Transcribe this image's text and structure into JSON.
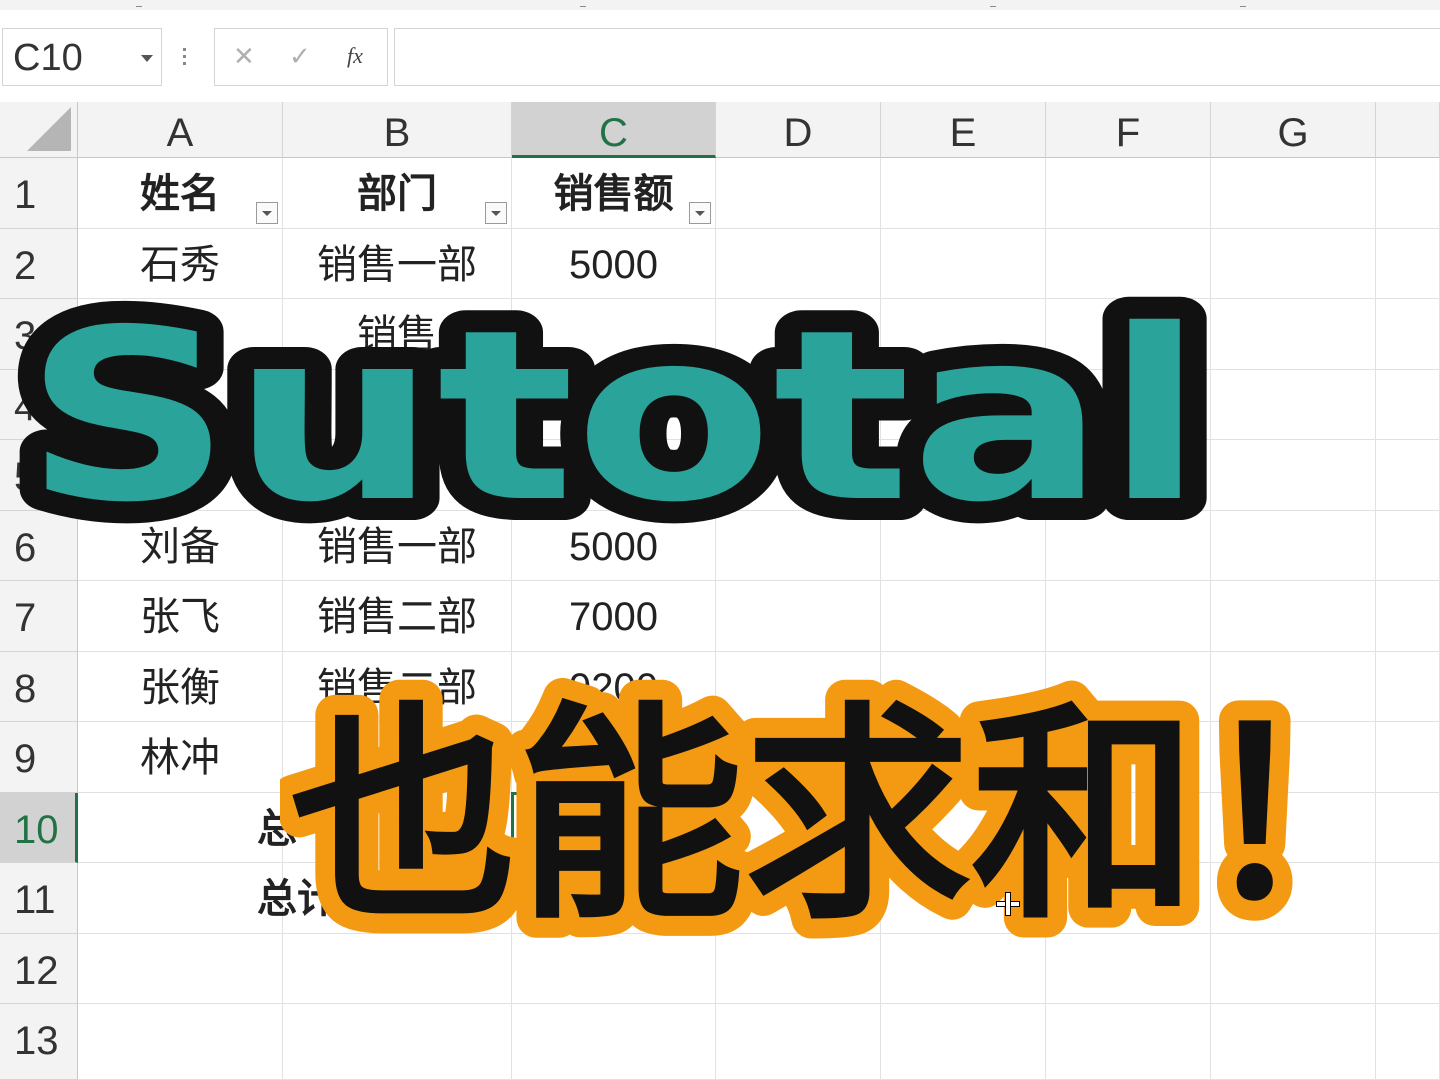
{
  "name_box": {
    "value": "C10"
  },
  "formula_bar": {
    "cancel_glyph": "✕",
    "enter_glyph": "✓",
    "fx_label": "fx",
    "content": ""
  },
  "columns": [
    "A",
    "B",
    "C",
    "D",
    "E",
    "F",
    "G"
  ],
  "rows": [
    "1",
    "2",
    "3",
    "4",
    "5",
    "6",
    "7",
    "8",
    "9",
    "10",
    "11",
    "12",
    "13"
  ],
  "table": {
    "headers": {
      "name": "姓名",
      "dept": "部门",
      "sales": "销售额"
    },
    "data": [
      {
        "name": "石秀",
        "dept": "销售一部",
        "sales": "5000"
      },
      {
        "name": "",
        "dept": "销售",
        "sales": ""
      },
      {
        "name": "",
        "dept": "",
        "sales": ""
      },
      {
        "name": "",
        "dept": "",
        "sales": ""
      },
      {
        "name": "刘备",
        "dept": "销售一部",
        "sales": "5000"
      },
      {
        "name": "张飞",
        "dept": "销售二部",
        "sales": "7000"
      },
      {
        "name": "张衡",
        "dept": "销售二部",
        "sales": "9200"
      },
      {
        "name": "林冲",
        "dept": "",
        "sales": ""
      }
    ],
    "row10_label": "总",
    "row11_label": "总计"
  },
  "overlay": {
    "title": "Sutotal",
    "subtitle": "也能求和！",
    "title_fill": "#2aa39a",
    "subtitle_fill": "#111111",
    "subtitle_stroke": "#f39a12",
    "outline": "#111111"
  },
  "colors": {
    "accent": "#217346",
    "header_bg": "#f3f3f3",
    "active_header_bg": "#d2d2d2"
  }
}
